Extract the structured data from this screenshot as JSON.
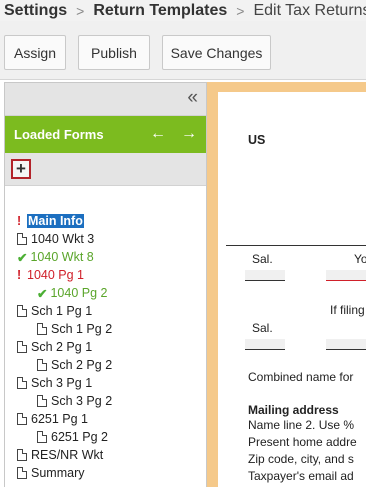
{
  "breadcrumb": [
    "Settings",
    "Return Templates",
    "Edit Tax Returns"
  ],
  "toolbar": {
    "assign": "Assign",
    "publish": "Publish",
    "save": "Save Changes"
  },
  "left_panel": {
    "collapse_icon": "«",
    "forms_title": "Loaded Forms",
    "prev_icon": "←",
    "next_icon": "→",
    "add_icon": "+"
  },
  "tree": [
    {
      "label": "Main Info",
      "status": "error-selected",
      "indent": 0,
      "icon": "none"
    },
    {
      "label": "1040 Wkt 3",
      "status": "normal",
      "indent": 0,
      "icon": "doc-icon"
    },
    {
      "label": "1040 Wkt 8",
      "status": "ok",
      "indent": 0,
      "icon": "check-icon"
    },
    {
      "label": "1040 Pg 1",
      "status": "error",
      "indent": 0,
      "icon": "none"
    },
    {
      "label": "1040 Pg 2",
      "status": "ok",
      "indent": 1,
      "icon": "check-icon"
    },
    {
      "label": "Sch 1 Pg 1",
      "status": "normal",
      "indent": 0,
      "icon": "doc-icon"
    },
    {
      "label": "Sch 1 Pg 2",
      "status": "normal",
      "indent": 1,
      "icon": "doc-icon"
    },
    {
      "label": "Sch 2 Pg 1",
      "status": "normal",
      "indent": 0,
      "icon": "doc-icon"
    },
    {
      "label": "Sch 2 Pg 2",
      "status": "normal",
      "indent": 1,
      "icon": "doc-icon"
    },
    {
      "label": "Sch 3 Pg 1",
      "status": "normal",
      "indent": 0,
      "icon": "doc-icon"
    },
    {
      "label": "Sch 3 Pg 2",
      "status": "normal",
      "indent": 1,
      "icon": "doc-icon"
    },
    {
      "label": "6251 Pg 1",
      "status": "normal",
      "indent": 0,
      "icon": "doc-icon"
    },
    {
      "label": "6251 Pg 2",
      "status": "normal",
      "indent": 1,
      "icon": "doc-icon"
    },
    {
      "label": "RES/NR Wkt",
      "status": "normal",
      "indent": 0,
      "icon": "doc-icon"
    },
    {
      "label": "Summary",
      "status": "normal",
      "indent": 0,
      "icon": "doc-icon"
    }
  ],
  "form": {
    "header": "US",
    "sal_1": "Sal.",
    "yo": "Yo",
    "if_filing": "If filing",
    "sal_2": "Sal.",
    "combined_name": "Combined name for",
    "mailing_heading": "Mailing address",
    "line_1": "Name line 2. Use %",
    "line_2": "Present home addre",
    "line_3": "Zip code, city, and s",
    "line_4": "Taxpayer's email ad"
  },
  "colors": {
    "accent_green": "#7cbb1f",
    "selected_blue": "#1c6fc0",
    "error_red": "#d0202a",
    "form_border": "#f5c98a"
  }
}
